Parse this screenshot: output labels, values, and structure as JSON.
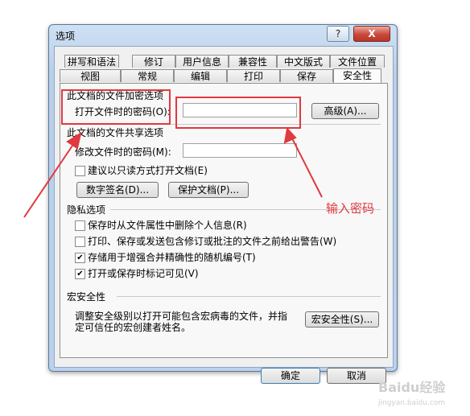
{
  "window": {
    "title": "选项",
    "help_label": "?",
    "close_label": "X"
  },
  "tabs": {
    "row1": [
      "拼写和语法",
      "修订",
      "用户信息",
      "兼容性",
      "中文版式",
      "文件位置"
    ],
    "row2": [
      "视图",
      "常规",
      "编辑",
      "打印",
      "保存",
      "安全性"
    ]
  },
  "encryption": {
    "title": "此文档的文件加密选项",
    "open_password_label": "打开文件时的密码(O):",
    "advanced_button": "高级(A)..."
  },
  "sharing": {
    "title": "此文档的文件共享选项",
    "modify_password_label": "修改文件时的密码(M):",
    "readonly_label": "建议以只读方式打开文档(E)",
    "readonly_checked": false,
    "digital_sign_button": "数字签名(D)...",
    "protect_button": "保护文档(P)..."
  },
  "privacy": {
    "title": "隐私选项",
    "options": [
      {
        "label": "保存时从文件属性中删除个人信息(R)",
        "checked": false
      },
      {
        "label": "打印、保存或发送包含修订或批注的文件之前给出警告(W)",
        "checked": false
      },
      {
        "label": "存储用于增强合并精确性的随机编号(T)",
        "checked": true
      },
      {
        "label": "打开或保存时标记可见(V)",
        "checked": true
      }
    ]
  },
  "macro": {
    "title": "宏安全性",
    "description_line1": "调整安全级别以打开可能包含宏病毒的文件，并指",
    "description_line2": "定可信任的宏创建者姓名。",
    "button": "宏安全性(S)..."
  },
  "footer": {
    "ok_button": "确定",
    "cancel_button": "取消"
  },
  "annotation_text": "输入密码",
  "watermark": {
    "brand": "Baidu经验",
    "url": "jingyan.baidu.com"
  },
  "colors": {
    "annotation": "#e0393f",
    "window_frame": "#b9d0ea"
  }
}
